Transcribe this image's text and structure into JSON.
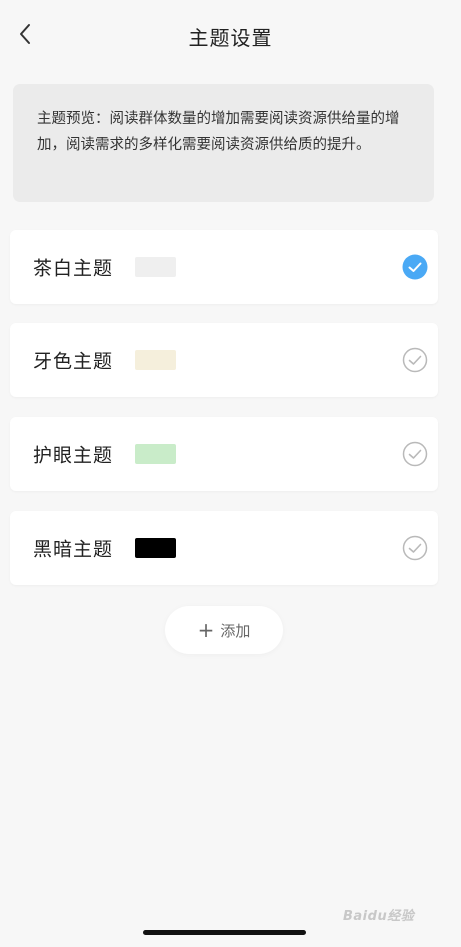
{
  "header": {
    "title": "主题设置",
    "back_icon": "chevron-left-icon"
  },
  "preview": {
    "text": "主题预览：阅读群体数量的增加需要阅读资源供给量的增加，阅读需求的多样化需要阅读资源供给质的提升。"
  },
  "themes": [
    {
      "name": "茶白主题",
      "swatch_color": "#efefef",
      "selected": true
    },
    {
      "name": "牙色主题",
      "swatch_color": "#f5efdc",
      "selected": false
    },
    {
      "name": "护眼主题",
      "swatch_color": "#c9ecc9",
      "selected": false
    },
    {
      "name": "黑暗主题",
      "swatch_color": "#000000",
      "selected": false
    }
  ],
  "add_button": {
    "label": "添加",
    "icon": "plus-icon"
  },
  "colors": {
    "accent": "#4aa9f5",
    "unchecked": "#b9b9b9"
  },
  "watermark": {
    "text": "Baidu经验"
  }
}
